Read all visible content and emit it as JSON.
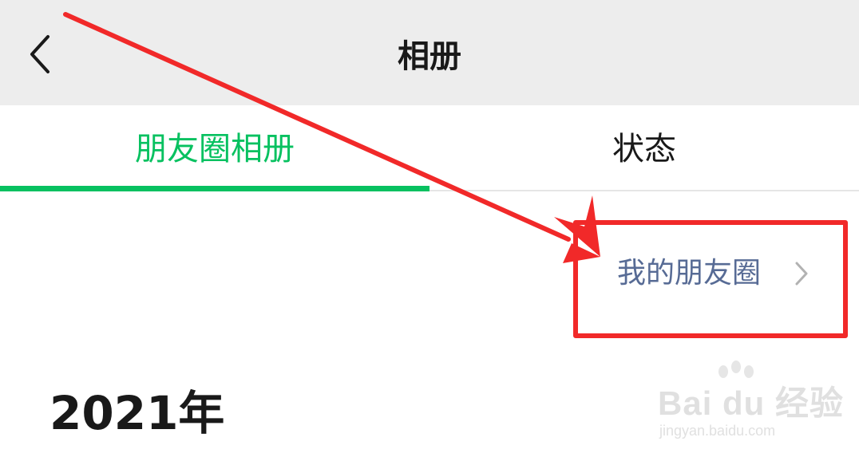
{
  "navbar": {
    "title": "相册",
    "back_icon": "chevron-left-icon"
  },
  "tabs": [
    {
      "label": "朋友圈相册",
      "active": true
    },
    {
      "label": "状态",
      "active": false
    }
  ],
  "moments_link": {
    "label": "我的朋友圈",
    "icon": "chevron-right-icon"
  },
  "year_heading": "2021年",
  "colors": {
    "accent_green": "#07c160",
    "link_blue": "#576b95",
    "annotation_red": "#f12929",
    "navbar_bg": "#ededed"
  },
  "watermark": {
    "brand": "Bai du 经验",
    "url": "jingyan.baidu.com"
  }
}
